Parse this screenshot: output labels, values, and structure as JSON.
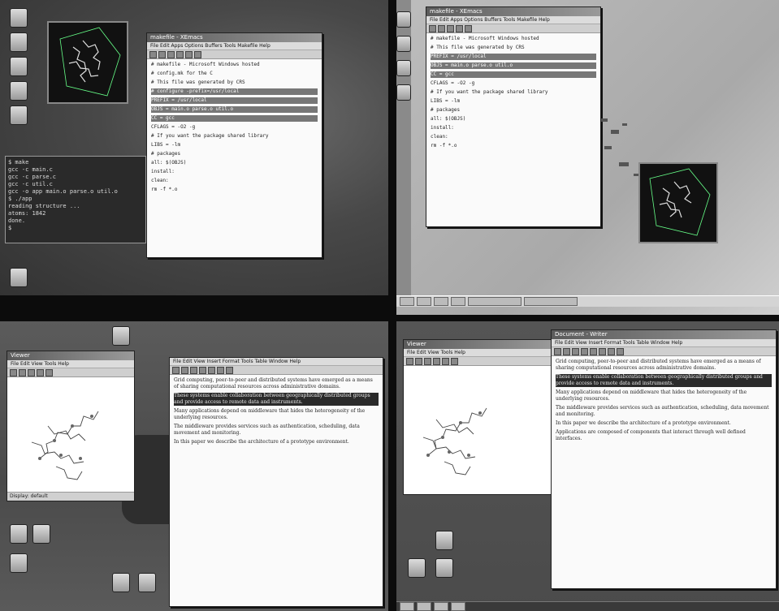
{
  "quadrants": {
    "top_left": {
      "editor": {
        "title": "makefile - XEmacs",
        "menu": "File  Edit  Apps  Options  Buffers  Tools  Makefile  Help",
        "lines": [
          "# makefile - Microsoft Windows hosted",
          "# config.mk for the C",
          "# This file was generated by CRS",
          "# configure  -prefix=/usr/local",
          "PREFIX    = /usr/local",
          "OBJS      = main.o parse.o util.o",
          "CC        = gcc",
          "CFLAGS    = -O2 -g",
          "# If you want the package shared library",
          "LIBS      = -lm",
          "# packages",
          "all: $(OBJS)",
          "install:",
          "clean:",
          "  rm -f *.o"
        ]
      },
      "terminal_lines": [
        "$ make",
        "gcc -c main.c",
        "gcc -c parse.c",
        "gcc -c util.c",
        "gcc -o app main.o parse.o util.o",
        "$ ./app",
        "reading structure ...",
        "atoms: 1842",
        "done.",
        "$"
      ]
    },
    "top_right": {
      "editor": {
        "title": "makefile - XEmacs",
        "menu": "File  Edit  Apps  Options  Buffers  Tools  Makefile  Help",
        "lines": [
          "# makefile - Microsoft Windows hosted",
          "# This file was generated by CRS",
          "PREFIX    = /usr/local",
          "OBJS      = main.o parse.o util.o",
          "CC        = gcc",
          "CFLAGS    = -O2 -g",
          "# If you want the package shared library",
          "LIBS      = -lm",
          "# packages",
          "all: $(OBJS)",
          "install:",
          "clean:",
          "  rm -f *.o"
        ]
      }
    },
    "bottom_left": {
      "viewer": {
        "title": "Viewer",
        "menu": "File  Edit  View  Tools  Help",
        "status": "Display: default"
      },
      "document": {
        "menu": "File  Edit  View  Insert  Format  Tools  Table  Window  Help",
        "paragraphs": [
          "Grid computing, peer-to-peer and distributed systems have emerged as a means of sharing computational resources across administrative domains.",
          "These systems enable collaboration between geographically distributed groups and provide access to remote data and instruments.",
          "Many applications depend on middleware that hides the heterogeneity of the underlying resources.",
          "The middleware provides services such as authentication, scheduling, data movement and monitoring.",
          "In this paper we describe the architecture of a prototype environment."
        ]
      }
    },
    "bottom_right": {
      "viewer": {
        "title": "Viewer",
        "menu": "File  Edit  View  Tools  Help"
      },
      "document": {
        "title": "Document - Writer",
        "menu": "File  Edit  View  Insert  Format  Tools  Table  Window  Help",
        "paragraphs": [
          "Grid computing, peer-to-peer and distributed systems have emerged as a means of sharing computational resources across administrative domains.",
          "These systems enable collaboration between geographically distributed groups and provide access to remote data and instruments.",
          "Many applications depend on middleware that hides the heterogeneity of the underlying resources.",
          "The middleware provides services such as authentication, scheduling, data movement and monitoring.",
          "In this paper we describe the architecture of a prototype environment.",
          "Applications are composed of components that interact through well defined interfaces."
        ]
      }
    }
  }
}
